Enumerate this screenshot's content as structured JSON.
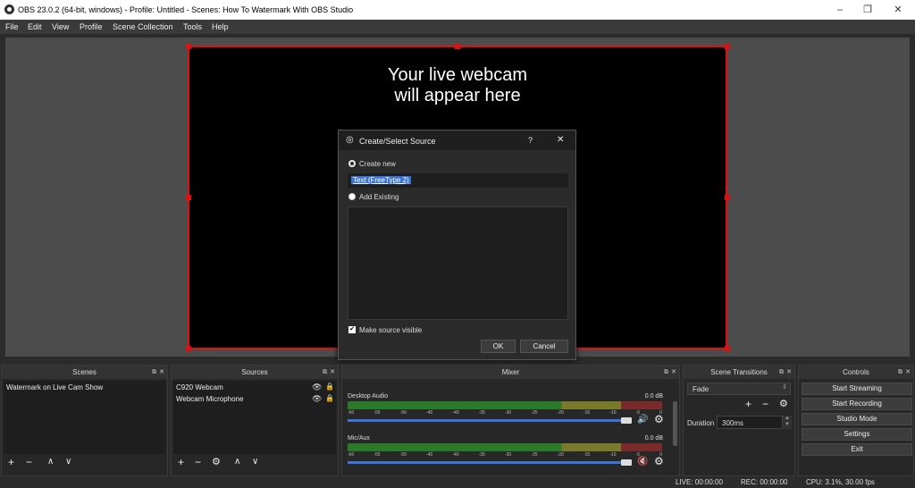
{
  "window": {
    "title": "OBS 23.0.2 (64-bit, windows) - Profile: Untitled - Scenes: How To Watermark With OBS Studio",
    "minimize_glyph": "–",
    "maximize_glyph": "❐",
    "close_glyph": "✕"
  },
  "menu": [
    "File",
    "Edit",
    "View",
    "Profile",
    "Scene Collection",
    "Tools",
    "Help"
  ],
  "preview": {
    "line1": "Your live webcam",
    "line2": "will appear here",
    "selection_color": "#e01010"
  },
  "dialog": {
    "title": "Create/Select Source",
    "help": "?",
    "close": "✕",
    "create_new_label": "Create new",
    "name_value": "Text (FreeType 2)",
    "add_existing_label": "Add Existing",
    "visible_label": "Make source visible",
    "ok_label": "OK",
    "cancel_label": "Cancel"
  },
  "scenes": {
    "title": "Scenes",
    "items": [
      "Watermark on Live Cam Show"
    ]
  },
  "sources": {
    "title": "Sources",
    "items": [
      "C920 Webcam",
      "Webcam Microphone"
    ]
  },
  "mixer": {
    "title": "Mixer",
    "ticks": [
      "-60",
      "-55",
      "-50",
      "-45",
      "-40",
      "-35",
      "-30",
      "-25",
      "-20",
      "-15",
      "-10",
      "-5",
      "0"
    ],
    "channels": [
      {
        "name": "Desktop Audio",
        "level": "0.0 dB",
        "muted": false
      },
      {
        "name": "Mic/Aux",
        "level": "0.0 dB",
        "muted": true
      }
    ]
  },
  "transitions": {
    "title": "Scene Transitions",
    "selected": "Fade",
    "duration_label": "Duration",
    "duration_value": "300ms"
  },
  "controls": {
    "title": "Controls",
    "buttons": [
      "Start Streaming",
      "Start Recording",
      "Studio Mode",
      "Settings",
      "Exit"
    ]
  },
  "status": {
    "live": "LIVE: 00:00:00",
    "rec": "REC: 00:00:00",
    "cpu": "CPU: 3.1%, 30.00 fps"
  },
  "colors": {
    "accent_blue": "#3a74d8",
    "mute_red": "#e03030"
  }
}
